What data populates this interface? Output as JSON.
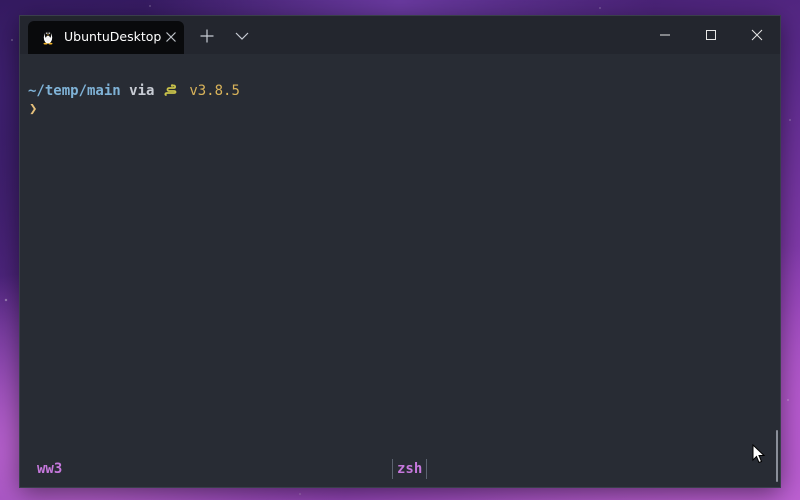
{
  "window": {
    "tab_title": "UbuntuDesktop"
  },
  "terminal": {
    "path": "~/temp/main",
    "via": "via",
    "python_version": "v3.8.5",
    "prompt_symbol": "❯"
  },
  "statusbar": {
    "session": "ww3",
    "shell": "zsh"
  },
  "colors": {
    "terminal_bg": "#282c34",
    "titlebar_bg": "#23262e",
    "active_tab_bg": "#090a0c",
    "path": "#7fb2d6",
    "python_version": "#d9b35a",
    "prompt": "#e5c07b",
    "status_accent": "#c678dd"
  },
  "icons": {
    "tab_icon": "linux-penguin-icon",
    "tab_close": "close-icon",
    "new_tab": "plus-icon",
    "dropdown": "chevron-down-icon",
    "python": "python-snake-icon",
    "minimize": "minimize-icon",
    "maximize": "maximize-icon",
    "close": "close-icon",
    "pointer": "mouse-pointer-icon"
  }
}
